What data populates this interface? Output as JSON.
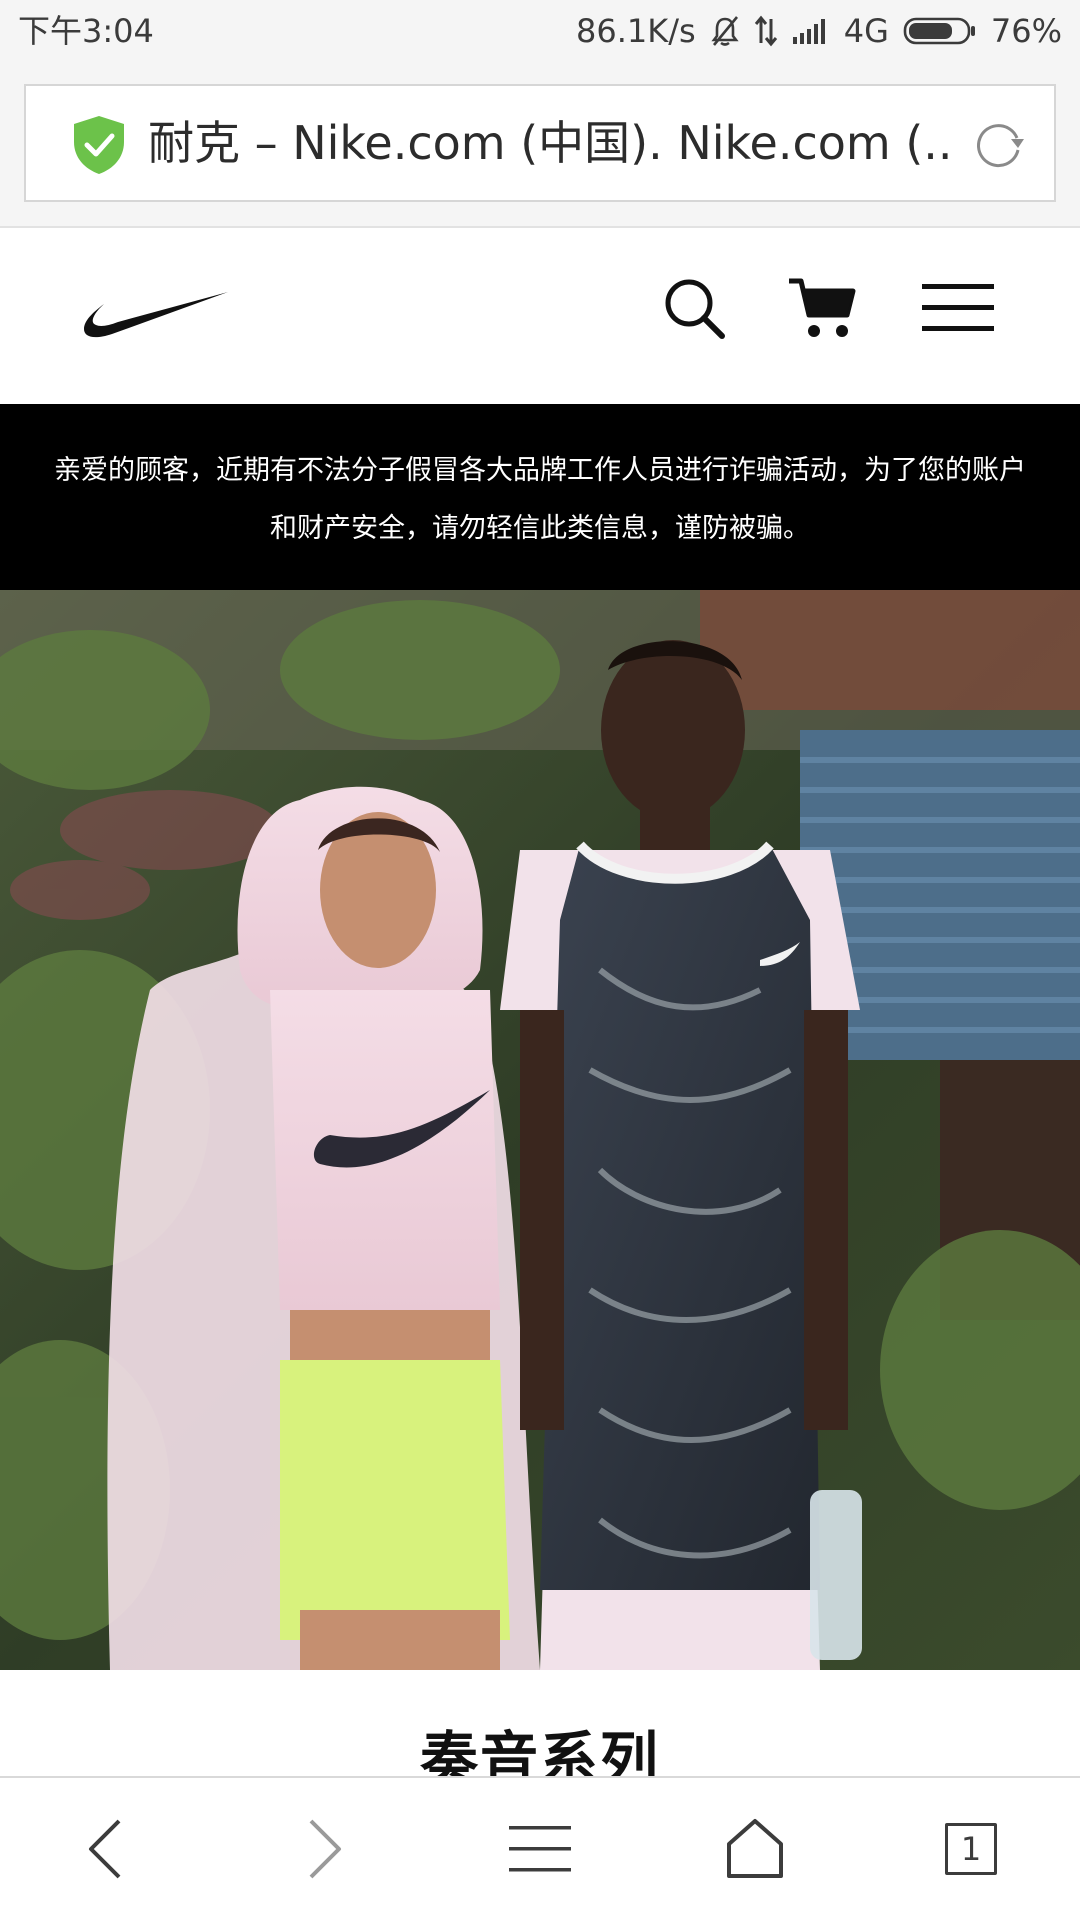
{
  "status_bar": {
    "time": "下午3:04",
    "network_speed": "86.1K/s",
    "network_type": "4G",
    "battery": "76%",
    "icons": [
      "mute-bell-icon",
      "data-transfer-icon",
      "signal-bars-icon",
      "battery-icon"
    ],
    "battery_level": 0.76
  },
  "browser": {
    "page_title": "耐克 – Nike.com (中国). Nike.com (...",
    "secure_icon": "shield-check-icon",
    "reload_icon": "reload-icon",
    "tab_count": "1",
    "bottom_icons": [
      "back-arrow-icon",
      "forward-arrow-icon",
      "menu-lines-icon",
      "home-icon",
      "tabs-icon"
    ]
  },
  "site_header": {
    "logo": "nike-swoosh-logo",
    "icons": [
      "search-icon",
      "cart-icon",
      "hamburger-menu-icon"
    ]
  },
  "notice": {
    "line1": "亲爱的顾客，近期有不法分子假冒各大品牌工作人员进行诈骗活动，为了您的账户",
    "line2": "和财产安全，请勿轻信此类信息，谨防被骗。"
  },
  "hero": {
    "image": "hero-photo-two-models"
  },
  "section": {
    "title": "奏音系列"
  },
  "colors": {
    "status_bg": "#f5f5f5",
    "shield_green": "#6cc24a",
    "banner_bg": "#000000",
    "banner_text": "#ffffff"
  }
}
